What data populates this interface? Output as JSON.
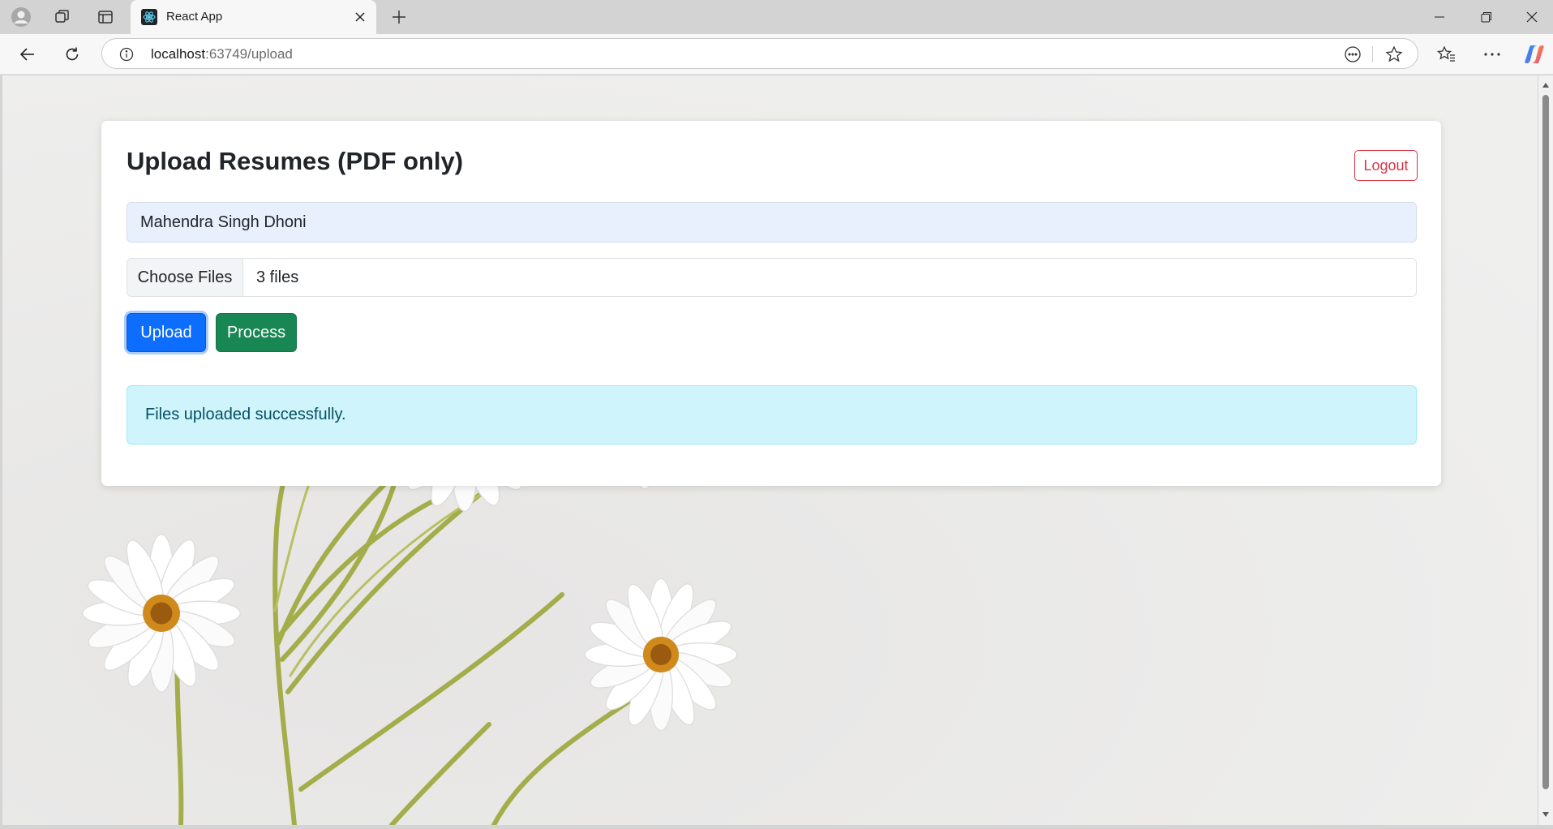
{
  "browser": {
    "tab": {
      "title": "React App",
      "favicon": "react-logo-icon"
    },
    "address": {
      "host": "localhost",
      "rest": ":63749/upload"
    }
  },
  "page": {
    "title": "Upload Resumes (PDF only)",
    "logout_label": "Logout",
    "name_value": "Mahendra Singh Dhoni",
    "file_button_label": "Choose Files",
    "file_status": "3 files",
    "upload_label": "Upload",
    "process_label": "Process",
    "alert_message": "Files uploaded successfully."
  },
  "colors": {
    "primary": "#0d6efd",
    "success": "#198754",
    "danger": "#dc3545",
    "info_bg": "#cff4fc",
    "info_text": "#055160",
    "autofill_bg": "#e8f0fe"
  }
}
